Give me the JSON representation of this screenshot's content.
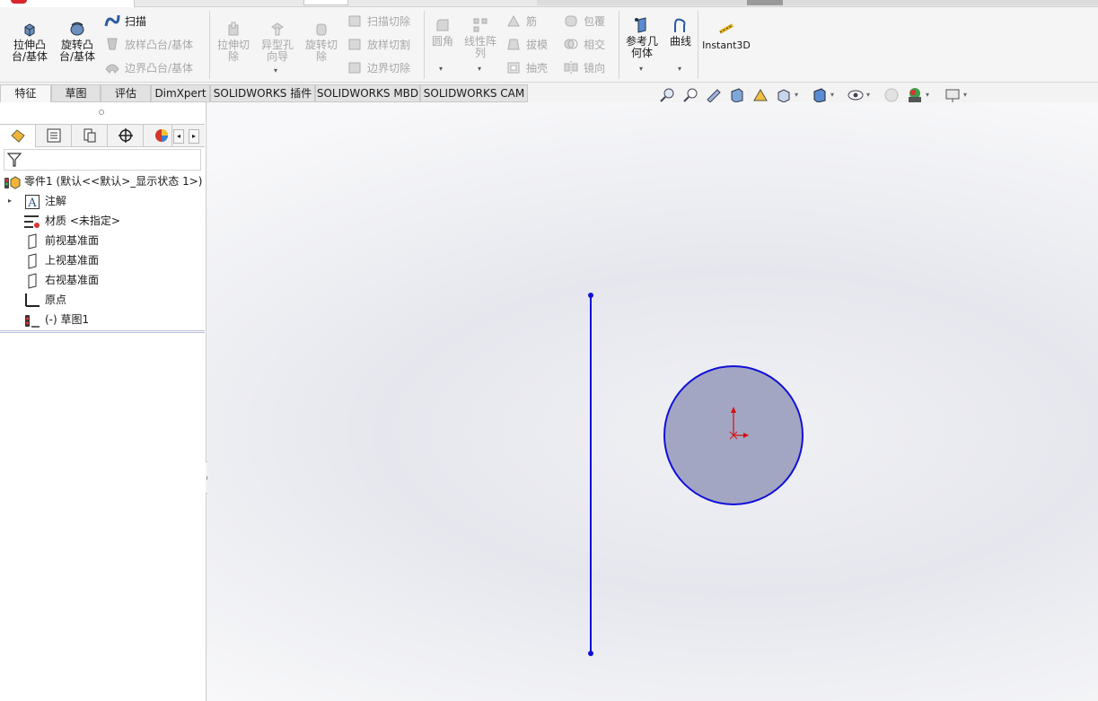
{
  "ribbon": {
    "extrude_boss": [
      "拉伸凸",
      "台/基体"
    ],
    "revolve_boss": [
      "旋转凸",
      "台/基体"
    ],
    "sweep": "扫描",
    "loft_boss": "放样凸台/基体",
    "boundary_boss": "边界凸台/基体",
    "extrude_cut": [
      "拉伸切",
      "除"
    ],
    "hole_wizard": [
      "异型孔",
      "向导"
    ],
    "revolve_cut": [
      "旋转切",
      "除"
    ],
    "swept_cut": "扫描切除",
    "lofted_cut": "放样切割",
    "boundary_cut": "边界切除",
    "fillet": "圆角",
    "linear_pattern": [
      "线性阵",
      "列"
    ],
    "rib": "筋",
    "draft": "拔模",
    "shell": "抽壳",
    "wrap": "包覆",
    "intersect": "相交",
    "mirror": "镜向",
    "reference_geometry": [
      "参考几",
      "何体"
    ],
    "curves": "曲线",
    "instant3d": "Instant3D"
  },
  "tabs": [
    "特征",
    "草图",
    "评估",
    "DimXpert",
    "SOLIDWORKS 插件",
    "SOLIDWORKS MBD",
    "SOLIDWORKS CAM"
  ],
  "active_tab": "特征",
  "tree": {
    "part": "零件1  (默认<<默认>_显示状态 1>)",
    "annotations": "注解",
    "material": "材质 <未指定>",
    "front_plane": "前视基准面",
    "top_plane": "上视基准面",
    "right_plane": "右视基准面",
    "origin": "原点",
    "sketch": "(-) 草图1"
  },
  "colors": {
    "sketch_line": "#1010d8",
    "circle_fill": "#a3a6c2",
    "origin": "#d41010"
  },
  "icons": [
    "extrude-icon",
    "revolve-icon",
    "sweep-icon",
    "fillet-icon",
    "reference-geometry-icon",
    "curves-icon",
    "instant3d-icon",
    "zoom-to-fit-icon",
    "zoom-area-icon",
    "previous-view-icon",
    "section-view-icon",
    "view-orientation-icon",
    "display-style-icon",
    "hide-show-icon",
    "appearance-icon",
    "scene-icon",
    "view-settings-icon",
    "filter-icon"
  ]
}
